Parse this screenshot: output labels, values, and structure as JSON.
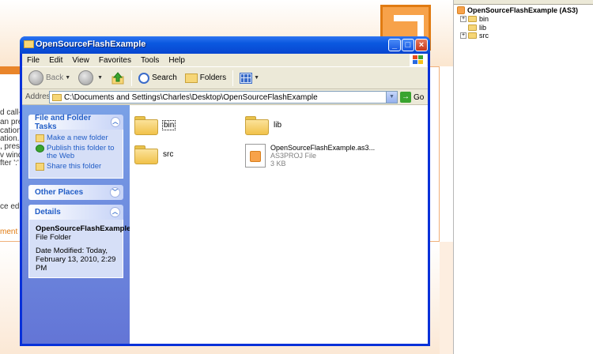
{
  "background": {
    "lines": [
      "d call-ti",
      "an pres",
      "cation.",
      "ation.",
      ", press",
      "v windo",
      "fter ':' c",
      "ce edito"
    ],
    "link": "ment"
  },
  "tree": {
    "root": "OpenSourceFlashExample (AS3)",
    "items": [
      "bin",
      "lib",
      "src"
    ]
  },
  "window": {
    "title": "OpenSourceFlashExample",
    "menu": [
      "File",
      "Edit",
      "View",
      "Favorites",
      "Tools",
      "Help"
    ],
    "toolbar": {
      "back": "Back",
      "search": "Search",
      "folders": "Folders"
    },
    "address": {
      "label": "Address",
      "value": "C:\\Documents and Settings\\Charles\\Desktop\\OpenSourceFlashExample",
      "go": "Go"
    },
    "taskpane": {
      "file_tasks": {
        "title": "File and Folder Tasks",
        "items": [
          "Make a new folder",
          "Publish this folder to the Web",
          "Share this folder"
        ]
      },
      "other_places": {
        "title": "Other Places"
      },
      "details": {
        "title": "Details",
        "name": "OpenSourceFlashExample",
        "type": "File Folder",
        "modified": "Date Modified: Today, February 13, 2010, 2:29 PM"
      }
    },
    "files": [
      {
        "name": "bin"
      },
      {
        "name": "lib"
      },
      {
        "name": "src"
      },
      {
        "name": "OpenSourceFlashExample.as3...",
        "type": "AS3PROJ File",
        "size": "3 KB"
      }
    ]
  }
}
